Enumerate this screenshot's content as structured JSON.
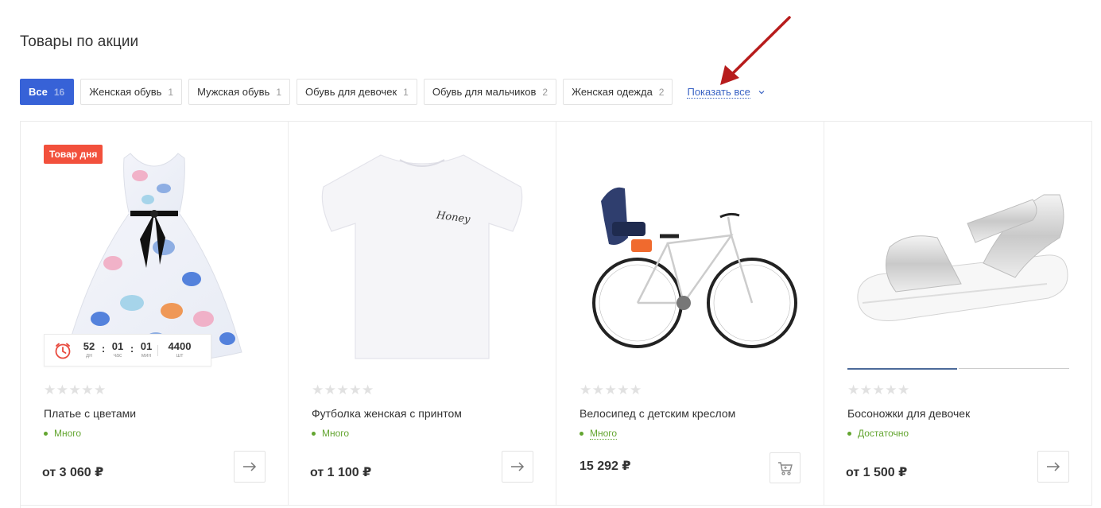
{
  "section": {
    "title": "Товары по акции"
  },
  "tabs": [
    {
      "label": "Все",
      "count": "16",
      "active": true
    },
    {
      "label": "Женская обувь",
      "count": "1"
    },
    {
      "label": "Мужская обувь",
      "count": "1"
    },
    {
      "label": "Обувь для девочек",
      "count": "1"
    },
    {
      "label": "Обувь для мальчиков",
      "count": "2"
    },
    {
      "label": "Женская одежда",
      "count": "2"
    }
  ],
  "show_all": {
    "label": "Показать все",
    "icon": "chevron-down-icon"
  },
  "annotation": {
    "icon": "red-arrow-icon",
    "color": "#b71c1c"
  },
  "products": [
    {
      "badge": "Товар дня",
      "timer": {
        "days": "52",
        "days_label": "дн",
        "hours": "01",
        "hours_label": "час",
        "minutes": "01",
        "minutes_label": "мин",
        "qty": "4400",
        "qty_label": "шт"
      },
      "rating": "★★★★★",
      "name": "Платье с цветами",
      "stock": "Много",
      "price": "от 3 060 ₽",
      "action_icon": "arrow-right-icon"
    },
    {
      "rating": "★★★★★",
      "name": "Футболка женская с принтом",
      "stock": "Много",
      "price": "от 1 100 ₽",
      "print_text": "Honey",
      "action_icon": "arrow-right-icon"
    },
    {
      "rating": "★★★★★",
      "name": "Велосипед с детским креслом",
      "stock": "Много",
      "price": "15 292 ₽",
      "action_icon": "cart-icon"
    },
    {
      "rating": "★★★★★",
      "name": "Босоножки для девочек",
      "stock": "Достаточно",
      "price": "от 1 500 ₽",
      "action_icon": "arrow-right-icon"
    }
  ],
  "colors": {
    "accent": "#3762d7",
    "badge": "#f2503c",
    "stock": "#63a530",
    "link": "#3a63c4"
  }
}
